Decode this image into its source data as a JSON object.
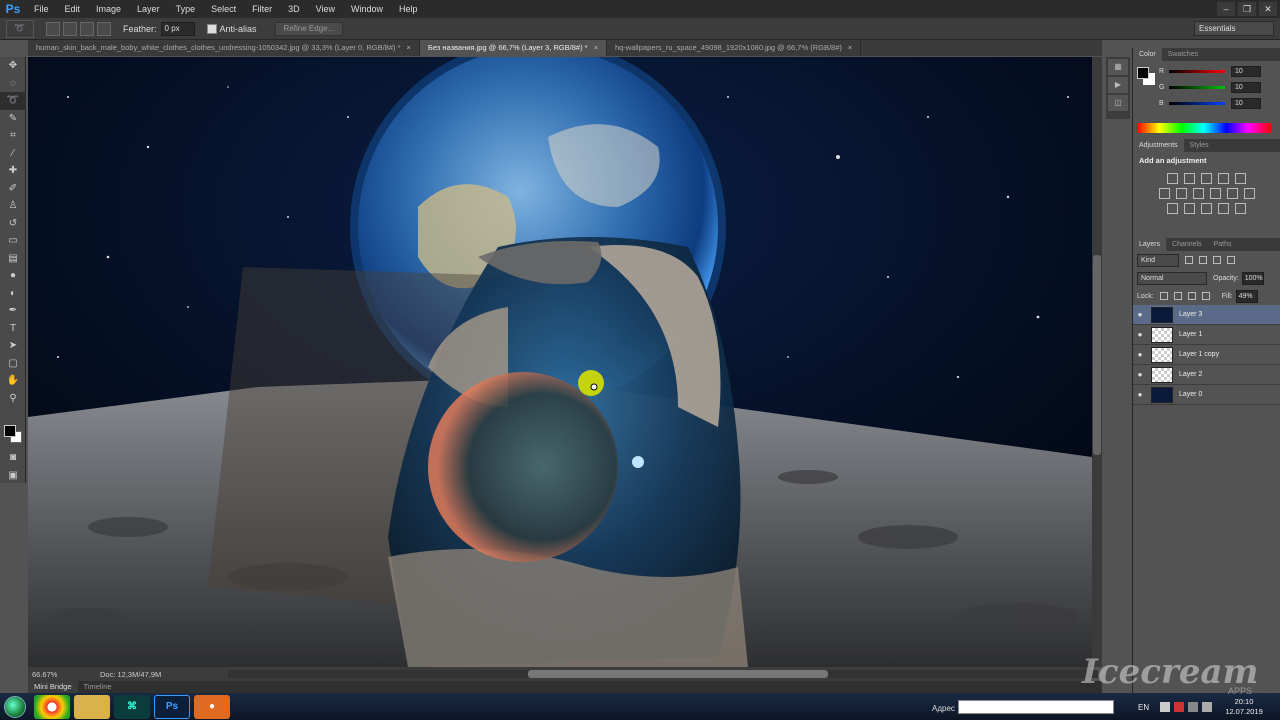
{
  "app": {
    "logo": "Ps"
  },
  "menu": [
    "File",
    "Edit",
    "Image",
    "Layer",
    "Type",
    "Select",
    "Filter",
    "3D",
    "View",
    "Window",
    "Help"
  ],
  "options": {
    "feather_label": "Feather:",
    "feather_value": "0 px",
    "antialias_label": "Anti-alias",
    "refine_label": "Refine Edge...",
    "workspace": "Essentials"
  },
  "tabs": [
    {
      "label": "human_skin_back_male_boby_white_clothes_clothes_undressing-1050342.jpg @ 33,3% (Layer 0, RGB/8#) *",
      "active": false
    },
    {
      "label": "Без названия.jpg @ 66,7% (Layer 3, RGB/8#) *",
      "active": true
    },
    {
      "label": "hq-wallpapers_ru_space_49098_1920x1080.jpg @ 66,7% (RGB/8#)",
      "active": false
    }
  ],
  "status": {
    "zoom": "66.67%",
    "doc": "Doc: 12,3M/47,9M"
  },
  "bottom_tabs": [
    "Mini Bridge",
    "Timeline"
  ],
  "color_panel": {
    "tabs": [
      "Color",
      "Swatches"
    ],
    "sliders": [
      {
        "label": "R",
        "value": "10",
        "color": "#ff0000"
      },
      {
        "label": "G",
        "value": "10",
        "color": "#00c000"
      },
      {
        "label": "B",
        "value": "10",
        "color": "#0040ff"
      }
    ]
  },
  "adjustments_panel": {
    "tabs": [
      "Adjustments",
      "Styles"
    ],
    "title": "Add an adjustment"
  },
  "layers_panel": {
    "tabs": [
      "Layers",
      "Channels",
      "Paths"
    ],
    "kind": "Kind",
    "blend_mode": "Normal",
    "opacity_label": "Opacity:",
    "opacity_value": "100%",
    "lock_label": "Lock:",
    "fill_label": "Fill:",
    "fill_value": "49%",
    "layers": [
      {
        "name": "Layer 3",
        "selected": true
      },
      {
        "name": "Layer 1",
        "selected": false
      },
      {
        "name": "Layer 1 copy",
        "selected": false
      },
      {
        "name": "Layer 2",
        "selected": false
      },
      {
        "name": "Layer 0",
        "selected": false
      }
    ]
  },
  "taskbar": {
    "address_label": "Адрес",
    "lang": "EN",
    "time": "20:10",
    "date": "12.07.2019"
  },
  "watermark": {
    "text": "Icecream",
    "sub": "APPS"
  }
}
